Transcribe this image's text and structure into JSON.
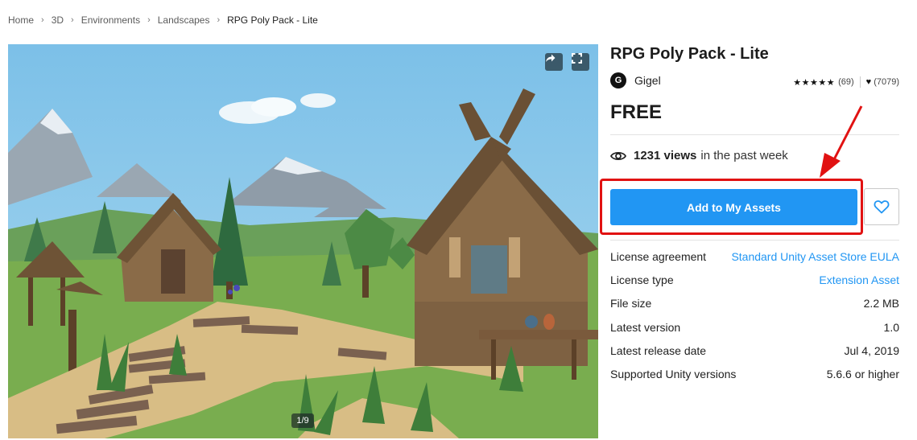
{
  "breadcrumb": [
    "Home",
    "3D",
    "Environments",
    "Landscapes",
    "RPG Poly Pack - Lite"
  ],
  "gallery": {
    "counter": "1/9",
    "share_icon": "share-icon",
    "fullscreen_icon": "fullscreen-icon"
  },
  "product": {
    "title": "RPG Poly Pack - Lite",
    "publisher_initial": "G",
    "publisher": "Gigel",
    "stars": "★★★★★",
    "rating_count": "(69)",
    "favorites_count": "(7079)",
    "price": "FREE",
    "views_count": "1231 views",
    "views_suffix": "in the past week",
    "add_button_label": "Add to My Assets",
    "accent_color": "#2196f3",
    "highlight_color": "#e11212"
  },
  "details": [
    {
      "label": "License agreement",
      "value": "Standard Unity Asset Store EULA",
      "link": true
    },
    {
      "label": "License type",
      "value": "Extension Asset",
      "link": true
    },
    {
      "label": "File size",
      "value": "2.2 MB",
      "link": false
    },
    {
      "label": "Latest version",
      "value": "1.0",
      "link": false
    },
    {
      "label": "Latest release date",
      "value": "Jul 4, 2019",
      "link": false
    },
    {
      "label": "Supported Unity versions",
      "value": "5.6.6 or higher",
      "link": false
    }
  ]
}
